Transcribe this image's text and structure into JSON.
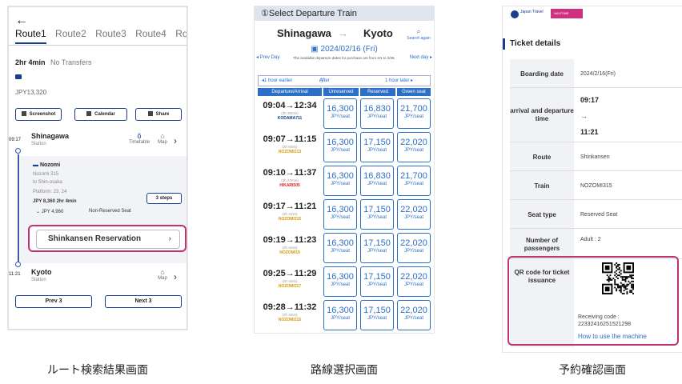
{
  "screen1": {
    "back_icon": "←",
    "tabs": [
      "Route1",
      "Route2",
      "Route3",
      "Route4",
      "Rout"
    ],
    "duration": "2hr 4min",
    "transfers": "No Transfers",
    "price": "JPY13,320",
    "buttons": {
      "screenshot": "Screenshot",
      "calendar": "Calendar",
      "share": "Share"
    },
    "origin": {
      "time": "09:17",
      "name": "Shinagawa",
      "sub": "Station",
      "timetable": "Timetable",
      "map": "Map"
    },
    "train": {
      "name": "Nozomi",
      "number": "Nozomi 315",
      "direction": "to Shin-osaka",
      "platform": "Platform: 23, 24",
      "fare": "JPY 8,360 2hr 4min",
      "subfare": "JPY 4,960",
      "seat": "Non-Reserved Seat",
      "steps": "3 steps"
    },
    "reservation_label": "Shinkansen Reservation",
    "destination": {
      "time": "11:21",
      "name": "Kyoto",
      "sub": "Station",
      "map": "Map"
    },
    "prev_label": "Prev 3",
    "next_label": "Next 3",
    "caption": "ルート検索結果画面"
  },
  "screen2": {
    "header": "①Select Departure Train",
    "from": "Shinagawa",
    "arrow": "→",
    "to": "Kyoto",
    "search_again": "Search again",
    "prev_day": "◂ Prev Day",
    "next_day": "Next day ▸",
    "date": "2024/02/16 (Fri)",
    "date_note": "The available departure dates for purchase are from 2/1 to 2/29.",
    "hour_earlier": "◂1 hour earlier",
    "after_time": "After 9:00",
    "hour_later": "1 hour later ▸",
    "columns": [
      "Departure/Arrival",
      "Unreserved",
      "Reserved",
      "Green seat"
    ],
    "unit": "JPY/seat",
    "rows": [
      {
        "time": "09:04→12:34",
        "dur": "(3h 30min)",
        "train": "KODAMA711",
        "cls": "blue",
        "fares": [
          "16,300",
          "16,830",
          "21,700"
        ]
      },
      {
        "time": "09:07→11:15",
        "dur": "(2h 8min)",
        "train": "NOZOMI213",
        "cls": "",
        "fares": [
          "16,300",
          "17,150",
          "22,020"
        ]
      },
      {
        "time": "09:10→11:37",
        "dur": "(2h 27min)",
        "train": "HIKARI505",
        "cls": "red",
        "fares": [
          "16,300",
          "16,830",
          "21,700"
        ]
      },
      {
        "time": "09:17→11:21",
        "dur": "(2h 4min)",
        "train": "NOZOMI315",
        "cls": "",
        "fares": [
          "16,300",
          "17,150",
          "22,020"
        ]
      },
      {
        "time": "09:19→11:23",
        "dur": "(2h 4min)",
        "train": "NOZOMI19",
        "cls": "",
        "fares": [
          "16,300",
          "17,150",
          "22,020"
        ]
      },
      {
        "time": "09:25→11:29",
        "dur": "(2h 4min)",
        "train": "NOZOMI317",
        "cls": "",
        "fares": [
          "16,300",
          "17,150",
          "22,020"
        ]
      },
      {
        "time": "09:28→11:32",
        "dur": "(2h 4min)",
        "train": "NOZOMI215",
        "cls": "",
        "fares": [
          "16,300",
          "17,150",
          "22,020"
        ]
      }
    ],
    "caption": "路線選択画面"
  },
  "screen3": {
    "logo1": "Japan Travel",
    "logo2": "NAVITIME",
    "title": "Ticket details",
    "rows": [
      {
        "label": "Boarding date",
        "value": "2024/2/16(Fri)"
      },
      {
        "label": "arrival and departure time",
        "value": "09:17 → 11:21"
      },
      {
        "label": "Route",
        "value": "Shinkansen"
      },
      {
        "label": "Train",
        "value": "NOZOMI315"
      },
      {
        "label": "Seat type",
        "value": "Reserved Seat"
      },
      {
        "label": "Number of passengers",
        "value": "Adult : 2"
      }
    ],
    "times": {
      "dep": "09:17",
      "arrow": "→",
      "arr": "11:21"
    },
    "qr_label": "QR code for ticket issuance",
    "receiving_label": "Receiving code :",
    "receiving_code": "22332416251521298",
    "howto": "How to use the machine",
    "caption": "予約確認画面"
  },
  "colors": {
    "accent": "#1a3d8f",
    "link": "#2b6fc7",
    "highlight": "#c0336e",
    "nozomi": "#d89a00",
    "hikari": "#e02020"
  }
}
